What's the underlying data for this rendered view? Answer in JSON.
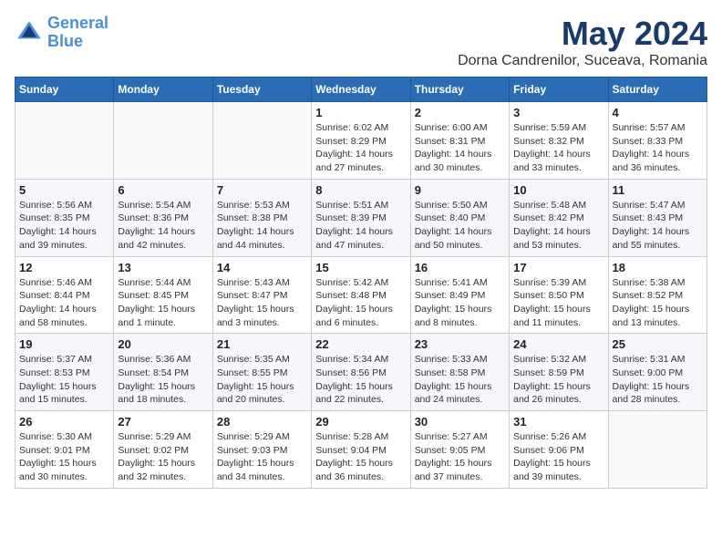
{
  "header": {
    "logo_line1": "General",
    "logo_line2": "Blue",
    "title": "May 2024",
    "subtitle": "Dorna Candrenilor, Suceava, Romania"
  },
  "weekdays": [
    "Sunday",
    "Monday",
    "Tuesday",
    "Wednesday",
    "Thursday",
    "Friday",
    "Saturday"
  ],
  "weeks": [
    [
      {
        "day": "",
        "info": ""
      },
      {
        "day": "",
        "info": ""
      },
      {
        "day": "",
        "info": ""
      },
      {
        "day": "1",
        "info": "Sunrise: 6:02 AM\nSunset: 8:29 PM\nDaylight: 14 hours and 27 minutes."
      },
      {
        "day": "2",
        "info": "Sunrise: 6:00 AM\nSunset: 8:31 PM\nDaylight: 14 hours and 30 minutes."
      },
      {
        "day": "3",
        "info": "Sunrise: 5:59 AM\nSunset: 8:32 PM\nDaylight: 14 hours and 33 minutes."
      },
      {
        "day": "4",
        "info": "Sunrise: 5:57 AM\nSunset: 8:33 PM\nDaylight: 14 hours and 36 minutes."
      }
    ],
    [
      {
        "day": "5",
        "info": "Sunrise: 5:56 AM\nSunset: 8:35 PM\nDaylight: 14 hours and 39 minutes."
      },
      {
        "day": "6",
        "info": "Sunrise: 5:54 AM\nSunset: 8:36 PM\nDaylight: 14 hours and 42 minutes."
      },
      {
        "day": "7",
        "info": "Sunrise: 5:53 AM\nSunset: 8:38 PM\nDaylight: 14 hours and 44 minutes."
      },
      {
        "day": "8",
        "info": "Sunrise: 5:51 AM\nSunset: 8:39 PM\nDaylight: 14 hours and 47 minutes."
      },
      {
        "day": "9",
        "info": "Sunrise: 5:50 AM\nSunset: 8:40 PM\nDaylight: 14 hours and 50 minutes."
      },
      {
        "day": "10",
        "info": "Sunrise: 5:48 AM\nSunset: 8:42 PM\nDaylight: 14 hours and 53 minutes."
      },
      {
        "day": "11",
        "info": "Sunrise: 5:47 AM\nSunset: 8:43 PM\nDaylight: 14 hours and 55 minutes."
      }
    ],
    [
      {
        "day": "12",
        "info": "Sunrise: 5:46 AM\nSunset: 8:44 PM\nDaylight: 14 hours and 58 minutes."
      },
      {
        "day": "13",
        "info": "Sunrise: 5:44 AM\nSunset: 8:45 PM\nDaylight: 15 hours and 1 minute."
      },
      {
        "day": "14",
        "info": "Sunrise: 5:43 AM\nSunset: 8:47 PM\nDaylight: 15 hours and 3 minutes."
      },
      {
        "day": "15",
        "info": "Sunrise: 5:42 AM\nSunset: 8:48 PM\nDaylight: 15 hours and 6 minutes."
      },
      {
        "day": "16",
        "info": "Sunrise: 5:41 AM\nSunset: 8:49 PM\nDaylight: 15 hours and 8 minutes."
      },
      {
        "day": "17",
        "info": "Sunrise: 5:39 AM\nSunset: 8:50 PM\nDaylight: 15 hours and 11 minutes."
      },
      {
        "day": "18",
        "info": "Sunrise: 5:38 AM\nSunset: 8:52 PM\nDaylight: 15 hours and 13 minutes."
      }
    ],
    [
      {
        "day": "19",
        "info": "Sunrise: 5:37 AM\nSunset: 8:53 PM\nDaylight: 15 hours and 15 minutes."
      },
      {
        "day": "20",
        "info": "Sunrise: 5:36 AM\nSunset: 8:54 PM\nDaylight: 15 hours and 18 minutes."
      },
      {
        "day": "21",
        "info": "Sunrise: 5:35 AM\nSunset: 8:55 PM\nDaylight: 15 hours and 20 minutes."
      },
      {
        "day": "22",
        "info": "Sunrise: 5:34 AM\nSunset: 8:56 PM\nDaylight: 15 hours and 22 minutes."
      },
      {
        "day": "23",
        "info": "Sunrise: 5:33 AM\nSunset: 8:58 PM\nDaylight: 15 hours and 24 minutes."
      },
      {
        "day": "24",
        "info": "Sunrise: 5:32 AM\nSunset: 8:59 PM\nDaylight: 15 hours and 26 minutes."
      },
      {
        "day": "25",
        "info": "Sunrise: 5:31 AM\nSunset: 9:00 PM\nDaylight: 15 hours and 28 minutes."
      }
    ],
    [
      {
        "day": "26",
        "info": "Sunrise: 5:30 AM\nSunset: 9:01 PM\nDaylight: 15 hours and 30 minutes."
      },
      {
        "day": "27",
        "info": "Sunrise: 5:29 AM\nSunset: 9:02 PM\nDaylight: 15 hours and 32 minutes."
      },
      {
        "day": "28",
        "info": "Sunrise: 5:29 AM\nSunset: 9:03 PM\nDaylight: 15 hours and 34 minutes."
      },
      {
        "day": "29",
        "info": "Sunrise: 5:28 AM\nSunset: 9:04 PM\nDaylight: 15 hours and 36 minutes."
      },
      {
        "day": "30",
        "info": "Sunrise: 5:27 AM\nSunset: 9:05 PM\nDaylight: 15 hours and 37 minutes."
      },
      {
        "day": "31",
        "info": "Sunrise: 5:26 AM\nSunset: 9:06 PM\nDaylight: 15 hours and 39 minutes."
      },
      {
        "day": "",
        "info": ""
      }
    ]
  ]
}
